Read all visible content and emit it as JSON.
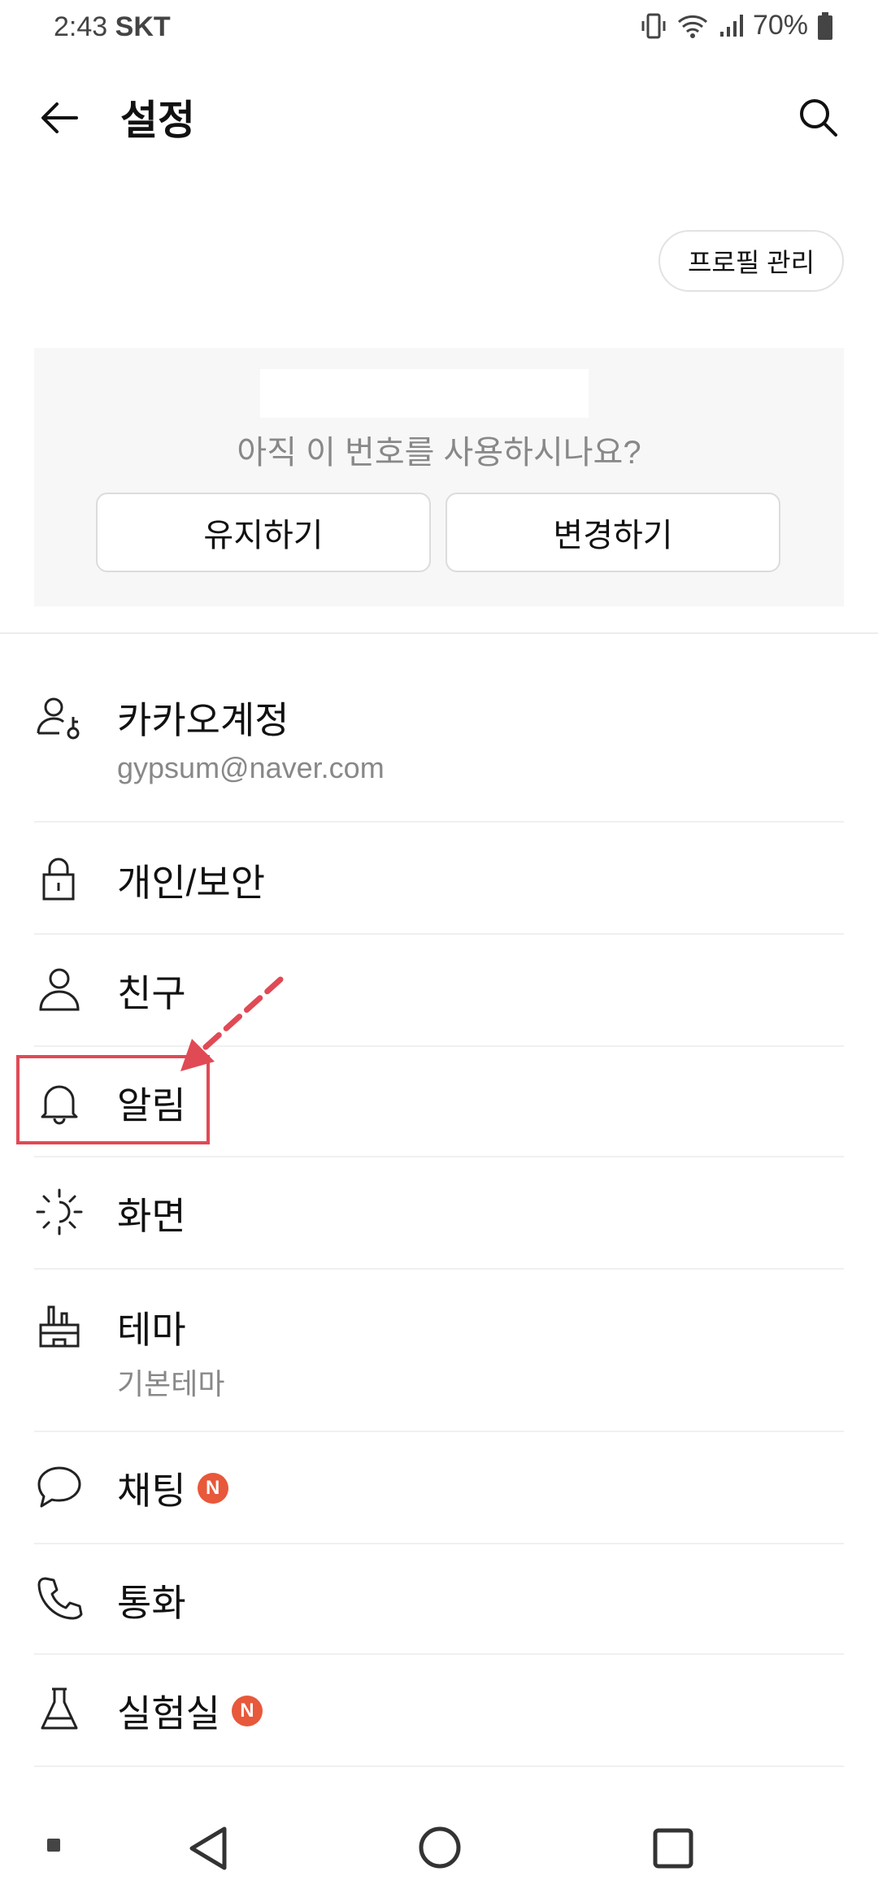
{
  "status_bar": {
    "time": "2:43",
    "carrier": "SKT",
    "battery": "70%"
  },
  "header": {
    "title": "설정"
  },
  "profile_button": "프로필 관리",
  "phone_card": {
    "question": "아직 이 번호를 사용하시나요?",
    "keep_label": "유지하기",
    "change_label": "변경하기"
  },
  "menu": [
    {
      "label": "카카오계정",
      "sub": "gypsum@naver.com",
      "icon": "kakao-account-icon"
    },
    {
      "label": "개인/보안",
      "icon": "lock-icon"
    },
    {
      "label": "친구",
      "icon": "person-icon"
    },
    {
      "label": "알림",
      "icon": "bell-icon"
    },
    {
      "label": "화면",
      "icon": "sun-icon"
    },
    {
      "label": "테마",
      "sub": "기본테마",
      "icon": "paint-brush-icon"
    },
    {
      "label": "채팅",
      "badge": "N",
      "icon": "chat-bubble-icon"
    },
    {
      "label": "통화",
      "icon": "phone-icon"
    },
    {
      "label": "실험실",
      "badge": "N",
      "icon": "flask-icon"
    }
  ],
  "colors": {
    "badge": "#e8583a",
    "annotation": "#e04a55"
  }
}
